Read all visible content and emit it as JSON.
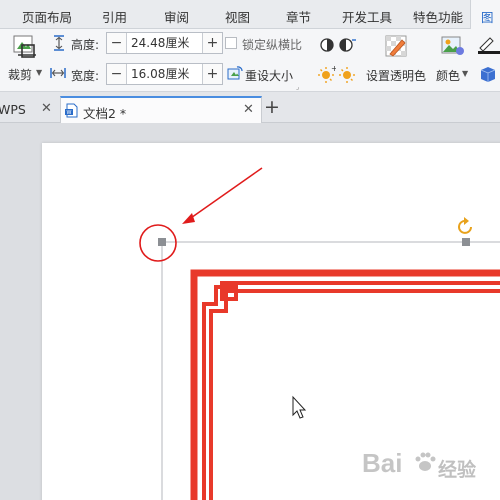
{
  "menu": {
    "tabs": [
      {
        "label": "页面布局"
      },
      {
        "label": "引用"
      },
      {
        "label": "审阅"
      },
      {
        "label": "视图"
      },
      {
        "label": "章节"
      },
      {
        "label": "开发工具"
      },
      {
        "label": "特色功能"
      },
      {
        "label": "图"
      }
    ],
    "active_index": 7
  },
  "ribbon": {
    "crop_label": "裁剪",
    "height_label": "高度:",
    "height_value": "24.48厘米",
    "width_label": "宽度:",
    "width_value": "16.08厘米",
    "lock_ratio_label": "锁定纵横比",
    "reset_size_label": "重设大小",
    "set_transparent_label": "设置透明色",
    "color_label": "颜色"
  },
  "doc_tabs": {
    "tab1_label": "WPS",
    "tab2_label": "文档2 *",
    "add_label": "+"
  },
  "watermark": {
    "brand": "Bai",
    "suffix": "经验"
  },
  "colors": {
    "border_red": "#e8392a",
    "annotation_red": "#e01b1b",
    "rotate_orange": "#e8a21c",
    "accent_blue": "#2a6cc9"
  }
}
